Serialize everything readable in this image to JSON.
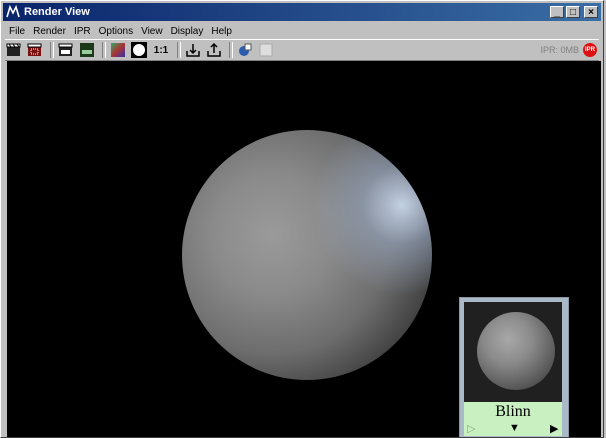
{
  "window": {
    "title": "Render View",
    "controls": {
      "minimize": "_",
      "maximize": "□",
      "close": "×"
    }
  },
  "menu": [
    "File",
    "Render",
    "IPR",
    "Options",
    "View",
    "Display",
    "Help"
  ],
  "toolbar": {
    "buttons": [
      {
        "name": "redo-previous-render-icon"
      },
      {
        "name": "render-region-icon"
      },
      {
        "name": "ipr-render-icon"
      },
      {
        "name": "refresh-ipr-icon"
      },
      {
        "name": "display-rgb-channels-icon"
      },
      {
        "name": "display-alpha-channel-icon"
      },
      {
        "name": "real-size-icon"
      },
      {
        "name": "keep-image-icon"
      },
      {
        "name": "remove-image-icon"
      },
      {
        "name": "render-globals-icon"
      },
      {
        "name": "blank-toolbar-icon"
      }
    ],
    "ratio_label": "1:1",
    "ipr_status": "IPR: 0MB",
    "ipr_badge": "IPR"
  },
  "swatch": {
    "material_name": "Blinn",
    "play_left": "▷",
    "menu_arrow": "▼",
    "play_right": "▶"
  },
  "colors": {
    "titlebar": "#0a246a",
    "viewport_bg": "#000000",
    "swatch_label_bg": "#c8f0c0",
    "ipr_badge": "#dd1111"
  }
}
